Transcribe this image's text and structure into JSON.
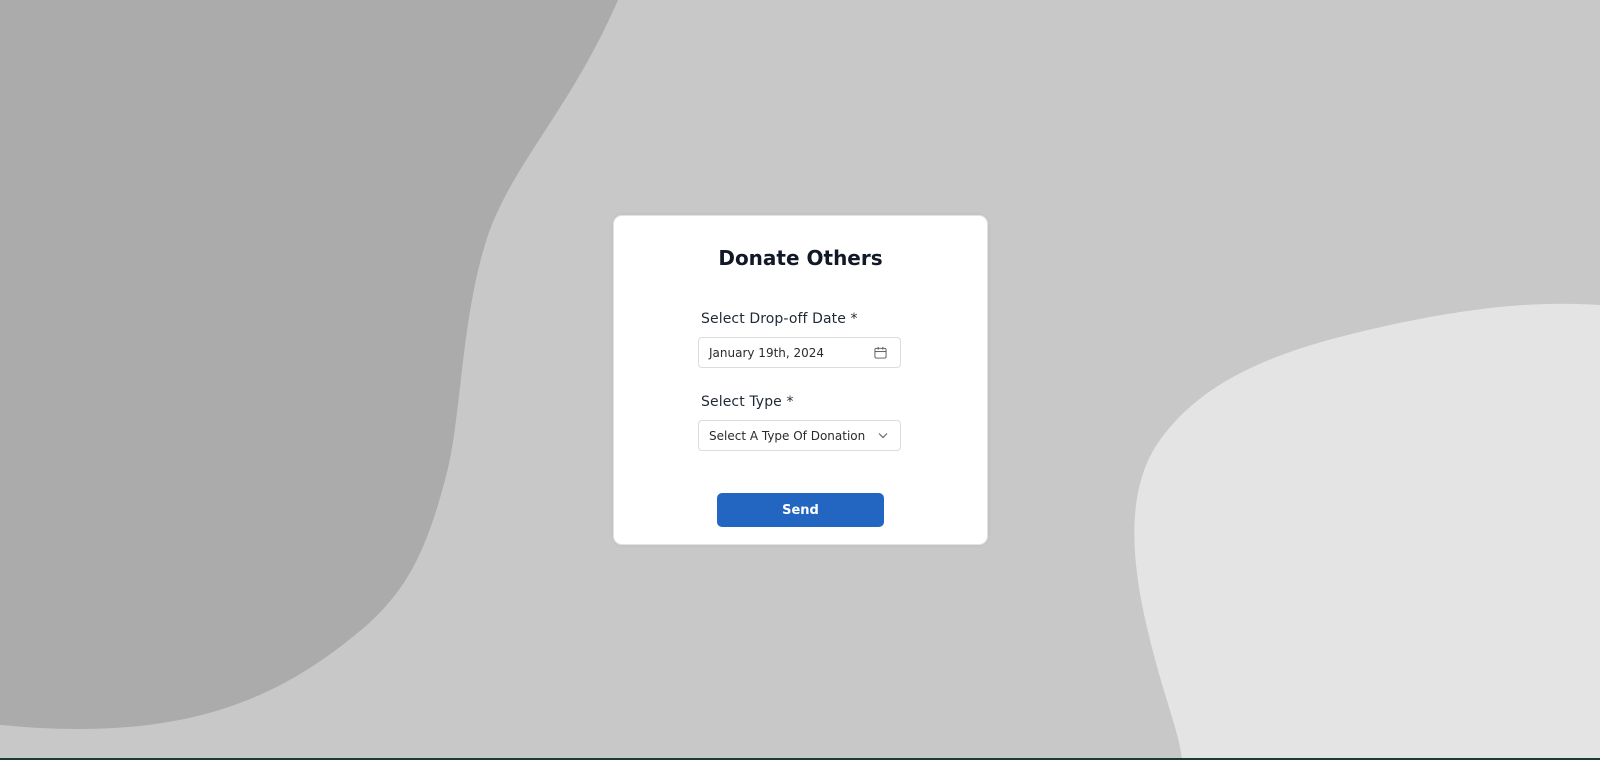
{
  "form": {
    "title": "Donate Others",
    "date_label": "Select Drop-off Date *",
    "date_value": "January 19th, 2024",
    "type_label": "Select Type *",
    "type_placeholder": "Select A Type Of Donation",
    "send_label": "Send"
  },
  "icons": {
    "date": "calendar-icon",
    "type": "chevron-down-icon"
  },
  "colors": {
    "background": "#c8c8c8",
    "shape_dark": "#ababab",
    "shape_light": "#e4e4e4",
    "card": "#ffffff",
    "primary_button": "#2266c1",
    "title_text": "#111827"
  }
}
